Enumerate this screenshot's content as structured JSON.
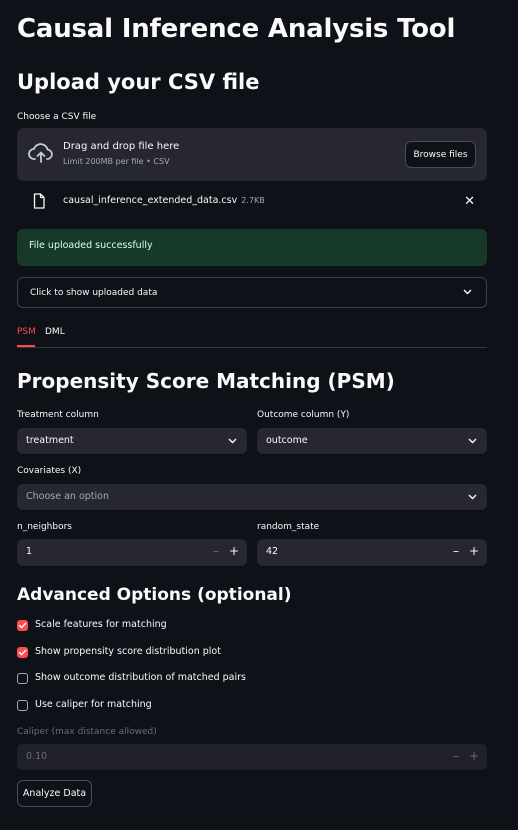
{
  "app": {
    "title": "Causal Inference Analysis Tool"
  },
  "upload": {
    "heading": "Upload your CSV file",
    "label": "Choose a CSV file",
    "drag_title": "Drag and drop file here",
    "limit_text": "Limit 200MB per file • CSV",
    "browse_label": "Browse files",
    "file_name": "causal_inference_extended_data.csv",
    "file_size": "2.7KB",
    "success_message": "File uploaded successfully",
    "expander_label": "Click to show uploaded data"
  },
  "tabs": [
    {
      "label": "PSM",
      "active": true
    },
    {
      "label": "DML",
      "active": false
    }
  ],
  "psm": {
    "heading": "Propensity Score Matching (PSM)",
    "treatment_label": "Treatment column",
    "treatment_value": "treatment",
    "outcome_label": "Outcome column (Y)",
    "outcome_value": "outcome",
    "covariates_label": "Covariates (X)",
    "covariates_placeholder": "Choose an option",
    "n_neighbors_label": "n_neighbors",
    "n_neighbors_value": "1",
    "random_state_label": "random_state",
    "random_state_value": "42",
    "minus": "–",
    "plus": "+"
  },
  "advanced": {
    "heading": "Advanced Options (optional)",
    "options": [
      {
        "label": "Scale features for matching",
        "checked": true
      },
      {
        "label": "Show propensity score distribution plot",
        "checked": true
      },
      {
        "label": "Show outcome distribution of matched pairs",
        "checked": false
      },
      {
        "label": "Use caliper for matching",
        "checked": false
      }
    ],
    "caliper_label": "Caliper (max distance allowed)",
    "caliper_value": "0.10",
    "analyze_label": "Analyze Data"
  },
  "colors": {
    "background": "#0e1117",
    "accent": "#ff4b4b",
    "widget_bg": "#262730",
    "success_bg": "#173928"
  }
}
